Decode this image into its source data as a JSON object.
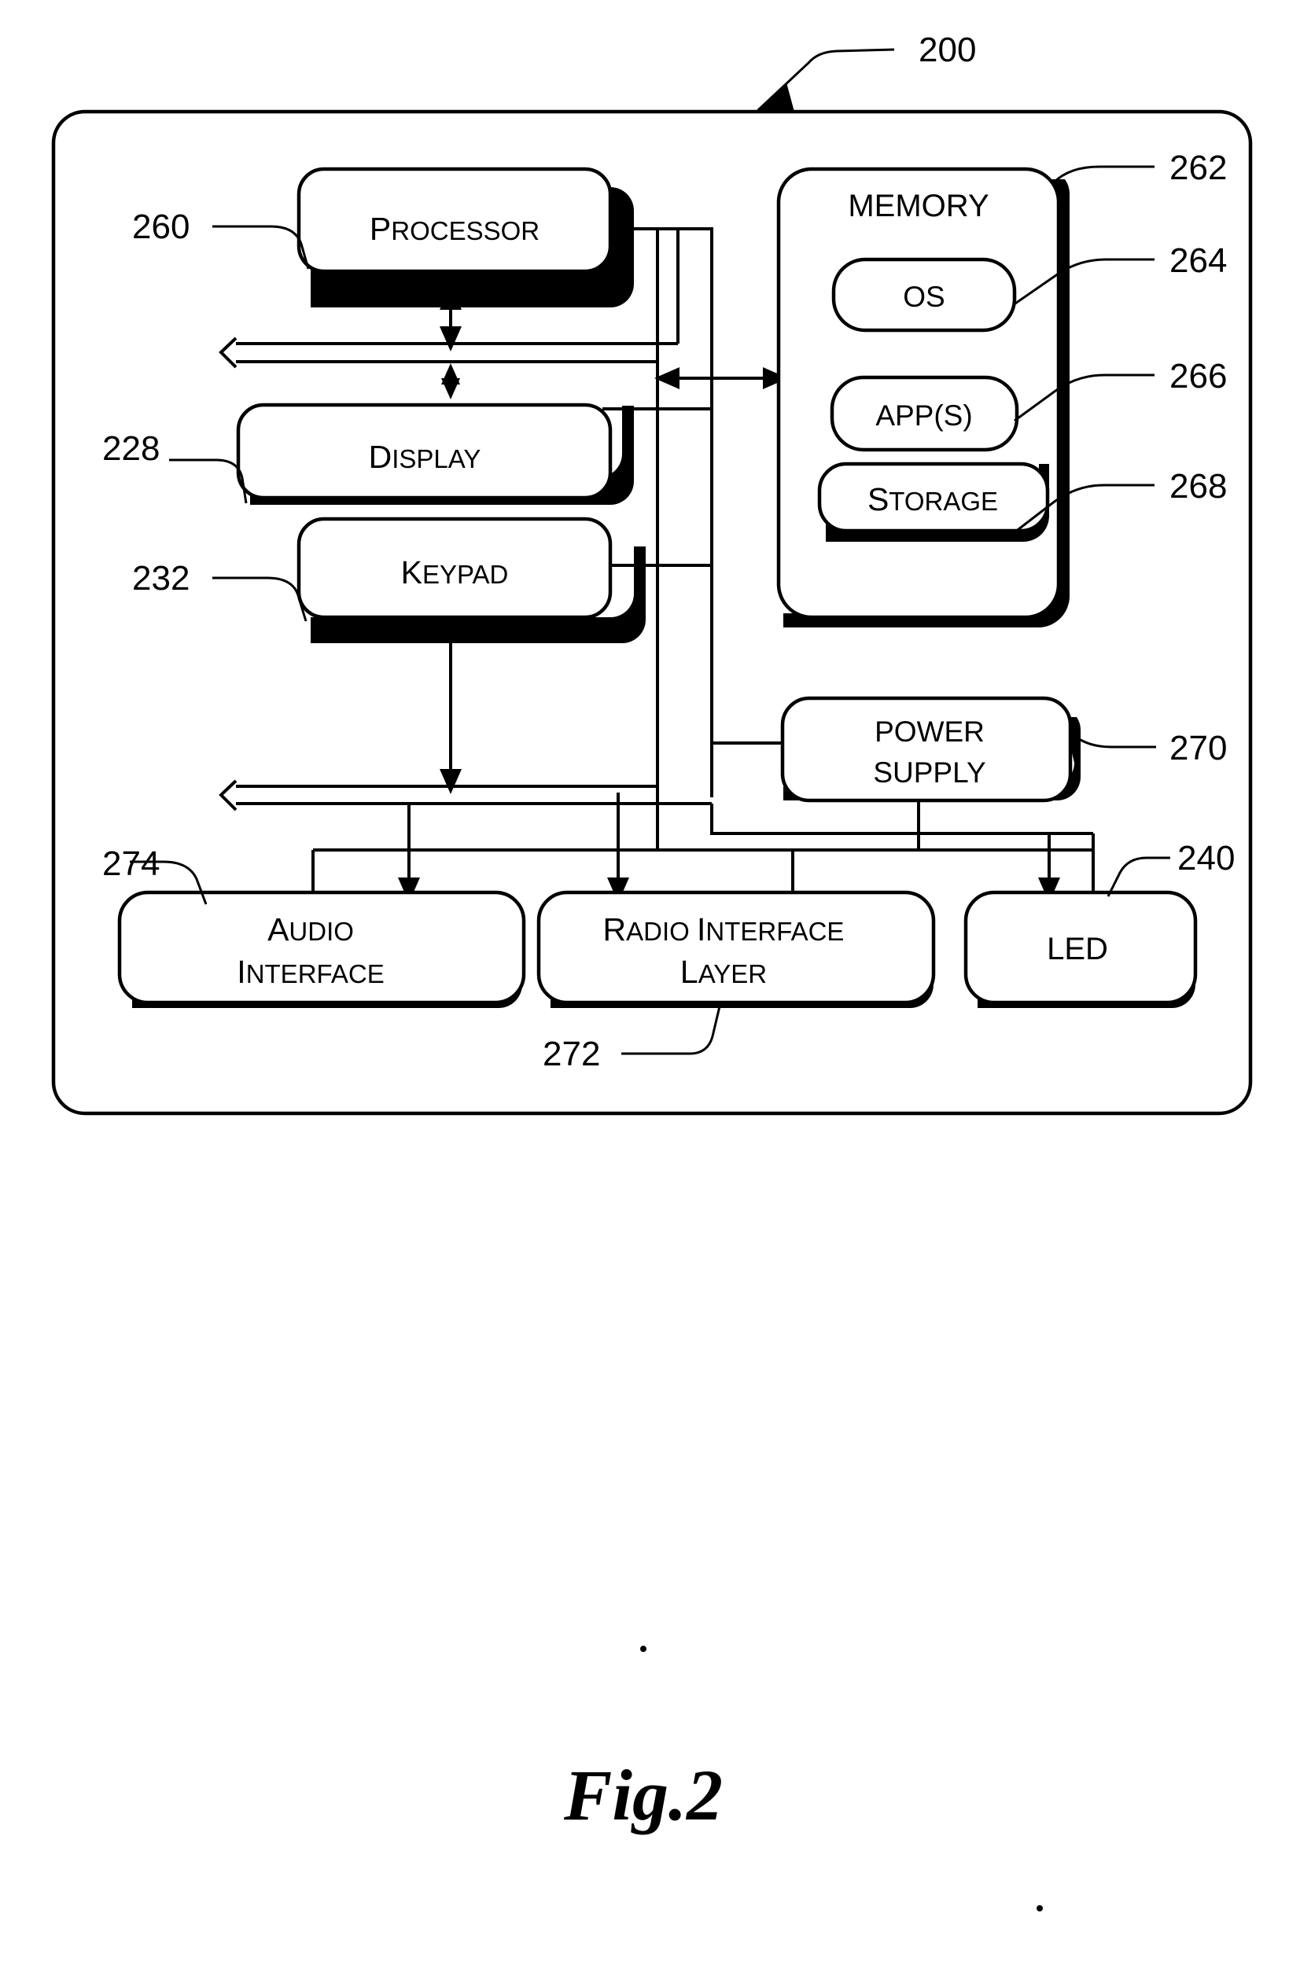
{
  "figure": {
    "caption": "Fig.2",
    "device_ref": "200"
  },
  "blocks": [
    {
      "id": "processor",
      "label": "PROCESSOR",
      "label_lines": [
        "PROCESSOR"
      ],
      "ref": "260",
      "style": "smallcaps"
    },
    {
      "id": "display",
      "label": "DISPLAY",
      "label_lines": [
        "DISPLAY"
      ],
      "ref": "228",
      "style": "smallcaps"
    },
    {
      "id": "keypad",
      "label": "KEYPAD",
      "label_lines": [
        "KEYPAD"
      ],
      "ref": "232",
      "style": "smallcaps"
    },
    {
      "id": "memory",
      "label": "MEMORY",
      "label_lines": [
        "MEMORY"
      ],
      "ref": "262",
      "style": "allcaps"
    },
    {
      "id": "os",
      "label": "OS",
      "label_lines": [
        "OS"
      ],
      "ref": "264",
      "style": "allcaps"
    },
    {
      "id": "apps",
      "label": "APP(S)",
      "label_lines": [
        "APP(S)"
      ],
      "ref": "266",
      "style": "allcaps"
    },
    {
      "id": "storage",
      "label": "STORAGE",
      "label_lines": [
        "STORAGE"
      ],
      "ref": "268",
      "style": "smallcaps"
    },
    {
      "id": "power-supply",
      "label": "POWER SUPPLY",
      "label_lines": [
        "POWER",
        "SUPPLY"
      ],
      "ref": "270",
      "style": "allcaps"
    },
    {
      "id": "audio-interface",
      "label": "AUDIO INTERFACE",
      "label_lines": [
        "AUDIO",
        "INTERFACE"
      ],
      "ref": "274",
      "style": "smallcaps"
    },
    {
      "id": "radio-interface-layer",
      "label": "RADIO INTERFACE LAYER",
      "label_lines": [
        "RADIO INTERFACE",
        "LAYER"
      ],
      "ref": "272",
      "style": "smallcaps"
    },
    {
      "id": "led",
      "label": "LED",
      "label_lines": [
        "LED"
      ],
      "ref": "240",
      "style": "allcaps"
    }
  ],
  "reference_numerals": {
    "device": "200",
    "processor": "260",
    "display": "228",
    "keypad": "232",
    "memory": "262",
    "os": "264",
    "apps": "266",
    "storage": "268",
    "power_supply": "270",
    "audio_interface": "274",
    "radio_interface_layer": "272",
    "led": "240"
  },
  "colors": {
    "stroke": "#000000",
    "fill": "#ffffff",
    "background": "#ffffff"
  }
}
